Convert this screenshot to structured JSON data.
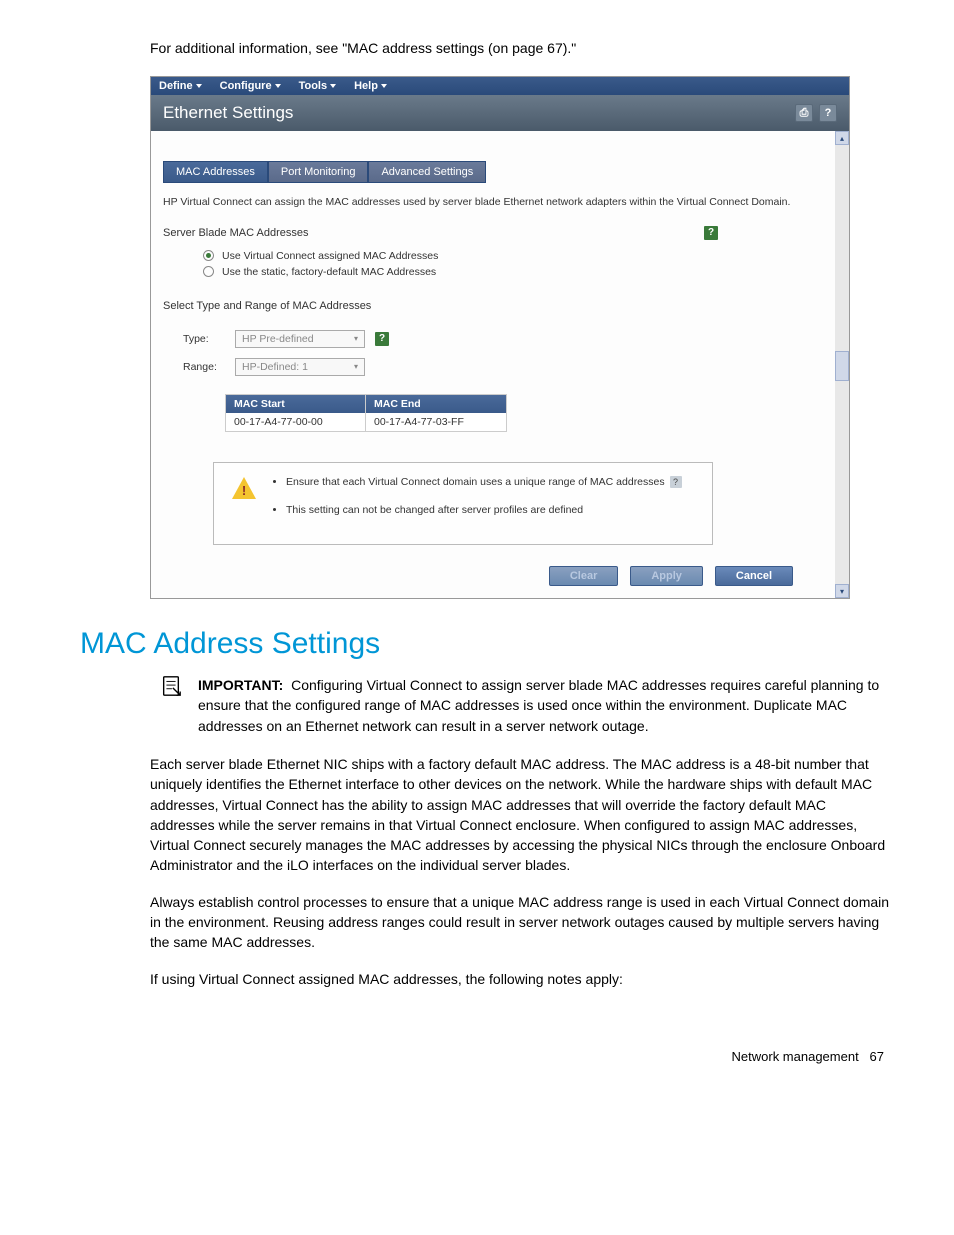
{
  "intro": "For additional information, see \"MAC address settings (on page 67).\"",
  "app": {
    "menubar": [
      "Define",
      "Configure",
      "Tools",
      "Help"
    ],
    "title": "Ethernet Settings",
    "tabs": [
      {
        "label": "MAC Addresses",
        "active": true
      },
      {
        "label": "Port Monitoring",
        "active": false
      },
      {
        "label": "Advanced Settings",
        "active": false
      }
    ],
    "description": "HP Virtual Connect can assign the MAC addresses used by server blade Ethernet network adapters within the Virtual Connect Domain.",
    "section1_title": "Server Blade MAC Addresses",
    "radios": {
      "opt1": "Use Virtual Connect assigned MAC Addresses",
      "opt2": "Use the static, factory-default MAC Addresses"
    },
    "section2_title": "Select Type and Range of MAC Addresses",
    "type_label": "Type:",
    "type_value": "HP Pre-defined",
    "range_label": "Range:",
    "range_value": "HP-Defined: 1",
    "table": {
      "h1": "MAC Start",
      "h2": "MAC End",
      "c1": "00-17-A4-77-00-00",
      "c2": "00-17-A4-77-03-FF"
    },
    "warn1": "Ensure that each Virtual Connect domain uses a unique range of MAC addresses",
    "warn2": "This setting can not be changed after server profiles are defined",
    "buttons": {
      "clear": "Clear",
      "apply": "Apply",
      "cancel": "Cancel"
    }
  },
  "doc": {
    "heading": "MAC Address Settings",
    "important_label": "IMPORTANT:",
    "important_body": "Configuring Virtual Connect to assign server blade MAC addresses requires careful planning to ensure that the configured range of MAC addresses is used once within the environment. Duplicate MAC addresses on an Ethernet network can result in a server network outage.",
    "p1": "Each server blade Ethernet NIC ships with a factory default MAC address. The MAC address is a 48-bit number that uniquely identifies the Ethernet interface to other devices on the network. While the hardware ships with default MAC addresses, Virtual Connect has the ability to assign MAC addresses that will override the factory default MAC addresses while the server remains in that Virtual Connect enclosure. When configured to assign MAC addresses, Virtual Connect securely manages the MAC addresses by accessing the physical NICs through the enclosure Onboard Administrator and the iLO interfaces on the individual server blades.",
    "p2": "Always establish control processes to ensure that a unique MAC address range is used in each Virtual Connect domain in the environment. Reusing address ranges could result in server network outages caused by multiple servers having the same MAC addresses.",
    "p3": "If using Virtual Connect assigned MAC addresses, the following notes apply:"
  },
  "footer": {
    "section": "Network management",
    "page": "67"
  }
}
